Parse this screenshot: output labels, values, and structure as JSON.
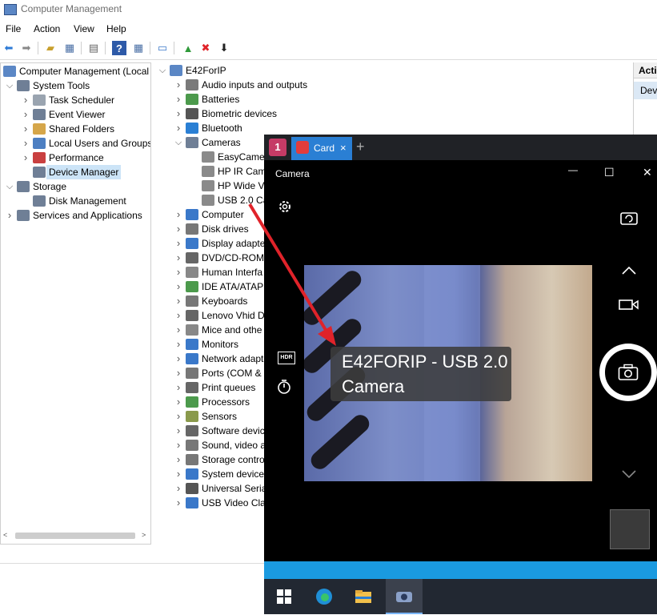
{
  "cm_window": {
    "title": "Computer Management",
    "menu": [
      "File",
      "Action",
      "View",
      "Help"
    ],
    "left_tree": [
      {
        "label": "Computer Management (Local",
        "level": 0,
        "arrow": ""
      },
      {
        "label": "System Tools",
        "level": 1,
        "arrow": "v"
      },
      {
        "label": "Task Scheduler",
        "level": 2,
        "arrow": ">"
      },
      {
        "label": "Event Viewer",
        "level": 2,
        "arrow": ">"
      },
      {
        "label": "Shared Folders",
        "level": 2,
        "arrow": ">"
      },
      {
        "label": "Local Users and Groups",
        "level": 2,
        "arrow": ">"
      },
      {
        "label": "Performance",
        "level": 2,
        "arrow": ">"
      },
      {
        "label": "Device Manager",
        "level": 2,
        "arrow": "",
        "selected": true
      },
      {
        "label": "Storage",
        "level": 1,
        "arrow": "v"
      },
      {
        "label": "Disk Management",
        "level": 2,
        "arrow": ""
      },
      {
        "label": "Services and Applications",
        "level": 1,
        "arrow": ">"
      }
    ],
    "device_tree": [
      {
        "label": "E42ForIP",
        "level": 0,
        "arrow": "v"
      },
      {
        "label": "Audio inputs and outputs",
        "level": 1,
        "arrow": ">"
      },
      {
        "label": "Batteries",
        "level": 1,
        "arrow": ">"
      },
      {
        "label": "Biometric devices",
        "level": 1,
        "arrow": ">"
      },
      {
        "label": "Bluetooth",
        "level": 1,
        "arrow": ">"
      },
      {
        "label": "Cameras",
        "level": 1,
        "arrow": "v"
      },
      {
        "label": "EasyCamer",
        "level": 2,
        "arrow": ""
      },
      {
        "label": "HP IR Cam",
        "level": 2,
        "arrow": ""
      },
      {
        "label": "HP Wide V",
        "level": 2,
        "arrow": ""
      },
      {
        "label": "USB 2.0 Ca",
        "level": 2,
        "arrow": ""
      },
      {
        "label": "Computer",
        "level": 1,
        "arrow": ">"
      },
      {
        "label": "Disk drives",
        "level": 1,
        "arrow": ">"
      },
      {
        "label": "Display adapte",
        "level": 1,
        "arrow": ">"
      },
      {
        "label": "DVD/CD-ROM",
        "level": 1,
        "arrow": ">"
      },
      {
        "label": "Human Interfa",
        "level": 1,
        "arrow": ">"
      },
      {
        "label": "IDE ATA/ATAPI",
        "level": 1,
        "arrow": ">"
      },
      {
        "label": "Keyboards",
        "level": 1,
        "arrow": ">"
      },
      {
        "label": "Lenovo Vhid D",
        "level": 1,
        "arrow": ">"
      },
      {
        "label": "Mice and othe",
        "level": 1,
        "arrow": ">"
      },
      {
        "label": "Monitors",
        "level": 1,
        "arrow": ">"
      },
      {
        "label": "Network adapt",
        "level": 1,
        "arrow": ">"
      },
      {
        "label": "Ports (COM &",
        "level": 1,
        "arrow": ">"
      },
      {
        "label": "Print queues",
        "level": 1,
        "arrow": ">"
      },
      {
        "label": "Processors",
        "level": 1,
        "arrow": ">"
      },
      {
        "label": "Sensors",
        "level": 1,
        "arrow": ">"
      },
      {
        "label": "Software devic",
        "level": 1,
        "arrow": ">"
      },
      {
        "label": "Sound, video a",
        "level": 1,
        "arrow": ">"
      },
      {
        "label": "Storage contro",
        "level": 1,
        "arrow": ">"
      },
      {
        "label": "System device",
        "level": 1,
        "arrow": ">"
      },
      {
        "label": "Universal Seria",
        "level": 1,
        "arrow": ">"
      },
      {
        "label": "USB Video Cla",
        "level": 1,
        "arrow": ">"
      }
    ],
    "actions_header": "Actio",
    "actions_item": "Devi"
  },
  "camera_window": {
    "tab_number": "1",
    "tab_label": "Card",
    "tab_close": "×",
    "new_tab": "+",
    "title": "Camera",
    "win_minimize": "—",
    "win_maximize": "☐",
    "win_close": "✕",
    "caption_line1": "E42FORIP - USB 2.0",
    "caption_line2": "Camera",
    "hdr_label": "HDR"
  }
}
